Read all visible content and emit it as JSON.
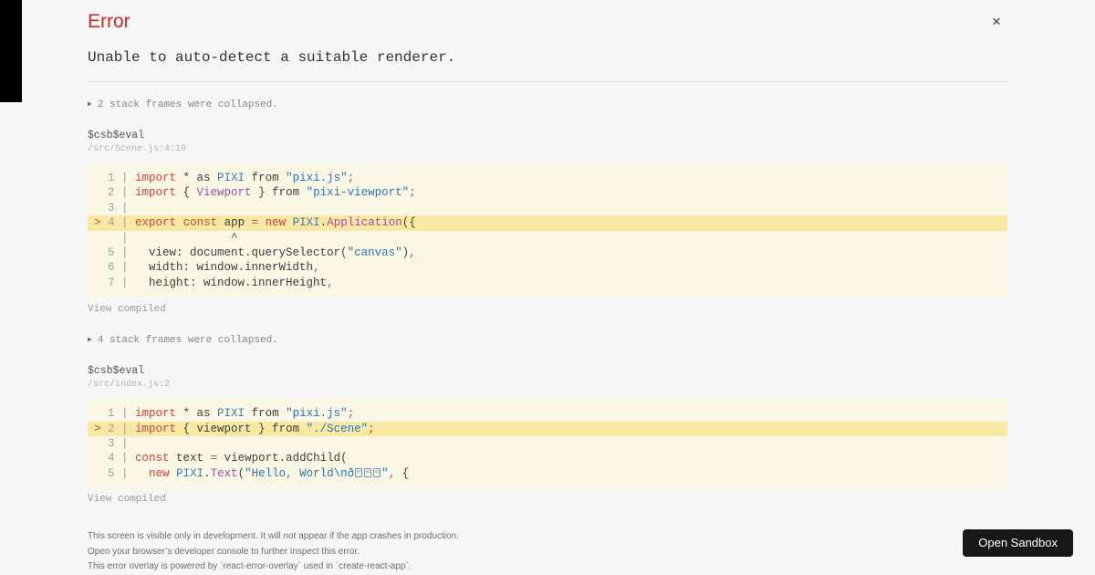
{
  "overlay": {
    "title": "Error",
    "close_icon": "×",
    "message": "Unable to auto-detect a suitable renderer.",
    "open_sandbox_label": "Open Sandbox",
    "footer_lines": [
      "This screen is visible only in development. It will not appear if the app crashes in production.",
      "Open your browser’s developer console to further inspect this error.",
      "This error overlay is powered by `react-error-overlay` used in `create-react-app`."
    ]
  },
  "colors": {
    "accent_red": "#cd2b2b",
    "keyword_red": "#d0453e",
    "identifier_blue": "#3e7ac2",
    "string_blue": "#2a73b7",
    "class_purple": "#a64ca6",
    "code_background": "#faf8e5",
    "highlight_yellow": "#f8e9a2",
    "page_background": "#f6f6f6",
    "button_background": "#171717"
  },
  "frames": [
    {
      "collapse_icon": "▶",
      "collapsed_label": "2 stack frames were collapsed.",
      "function_name": "$csb$eval",
      "location": "/src/Scene.js:4:19",
      "view_compiled_label": "View compiled",
      "code": {
        "lines": [
          {
            "highlight": false,
            "tokens": [
              [
                "g",
                "  1 | "
              ],
              [
                "k",
                "import"
              ],
              [
                "t",
                " * as "
              ],
              [
                "b",
                "PIXI"
              ],
              [
                "t",
                " from "
              ],
              [
                "s",
                "\"pixi.js\""
              ],
              [
                "k",
                ";"
              ]
            ]
          },
          {
            "highlight": false,
            "tokens": [
              [
                "g",
                "  2 | "
              ],
              [
                "k",
                "import"
              ],
              [
                "t",
                " { "
              ],
              [
                "c",
                "Viewport"
              ],
              [
                "t",
                " } from "
              ],
              [
                "s",
                "\"pixi-viewport\""
              ],
              [
                "k",
                ";"
              ]
            ]
          },
          {
            "highlight": false,
            "tokens": [
              [
                "g",
                "  3 | "
              ]
            ]
          },
          {
            "highlight": true,
            "tokens": [
              [
                "m",
                "> "
              ],
              [
                "g",
                "4 | "
              ],
              [
                "k",
                "export"
              ],
              [
                "t",
                " "
              ],
              [
                "k",
                "const"
              ],
              [
                "t",
                " app "
              ],
              [
                "k",
                "="
              ],
              [
                "t",
                " "
              ],
              [
                "k",
                "new"
              ],
              [
                "t",
                " "
              ],
              [
                "b",
                "PIXI"
              ],
              [
                "t",
                "."
              ],
              [
                "c",
                "Application"
              ],
              [
                "t",
                "({"
              ]
            ]
          },
          {
            "highlight": false,
            "tokens": [
              [
                "g",
                "    | "
              ],
              [
                "w",
                "              ^"
              ]
            ]
          },
          {
            "highlight": false,
            "tokens": [
              [
                "g",
                "  5 | "
              ],
              [
                "t",
                "  view: document.querySelector("
              ],
              [
                "s",
                "\"canvas\""
              ],
              [
                "t",
                ")"
              ],
              [
                "k",
                ","
              ]
            ]
          },
          {
            "highlight": false,
            "tokens": [
              [
                "g",
                "  6 | "
              ],
              [
                "t",
                "  width: window.innerWidth"
              ],
              [
                "k",
                ","
              ]
            ]
          },
          {
            "highlight": false,
            "tokens": [
              [
                "g",
                "  7 | "
              ],
              [
                "t",
                "  height: window.innerHeight"
              ],
              [
                "k",
                ","
              ]
            ]
          }
        ]
      }
    },
    {
      "collapse_icon": "▶",
      "collapsed_label": "4 stack frames were collapsed.",
      "function_name": "$csb$eval",
      "location": "/src/index.js:2",
      "view_compiled_label": "View compiled",
      "code": {
        "lines": [
          {
            "highlight": false,
            "tokens": [
              [
                "g",
                "  1 | "
              ],
              [
                "k",
                "import"
              ],
              [
                "t",
                " * as "
              ],
              [
                "b",
                "PIXI"
              ],
              [
                "t",
                " from "
              ],
              [
                "s",
                "\"pixi.js\""
              ],
              [
                "k",
                ";"
              ]
            ]
          },
          {
            "highlight": true,
            "tokens": [
              [
                "m",
                "> "
              ],
              [
                "g",
                "2 | "
              ],
              [
                "k",
                "import"
              ],
              [
                "t",
                " { viewport } from "
              ],
              [
                "s",
                "\"./Scene\""
              ],
              [
                "k",
                ";"
              ]
            ]
          },
          {
            "highlight": false,
            "tokens": [
              [
                "g",
                "  3 | "
              ]
            ]
          },
          {
            "highlight": false,
            "tokens": [
              [
                "g",
                "  4 | "
              ],
              [
                "k",
                "const"
              ],
              [
                "t",
                " text "
              ],
              [
                "k",
                "="
              ],
              [
                "t",
                " viewport.addChild("
              ]
            ]
          },
          {
            "highlight": false,
            "tokens": [
              [
                "g",
                "  5 | "
              ],
              [
                "t",
                "  "
              ],
              [
                "k",
                "new"
              ],
              [
                "t",
                " "
              ],
              [
                "b",
                "PIXI"
              ],
              [
                "t",
                "."
              ],
              [
                "c",
                "Text"
              ],
              [
                "t",
                "("
              ],
              [
                "s",
                "\"Hello, World\\nð"
              ],
              [
                "x",
                "9F"
              ],
              [
                "x",
                "8C"
              ],
              [
                "x",
                "8D"
              ],
              [
                "s",
                "\""
              ],
              [
                "k",
                ","
              ],
              [
                "t",
                " {"
              ]
            ]
          }
        ]
      }
    }
  ]
}
